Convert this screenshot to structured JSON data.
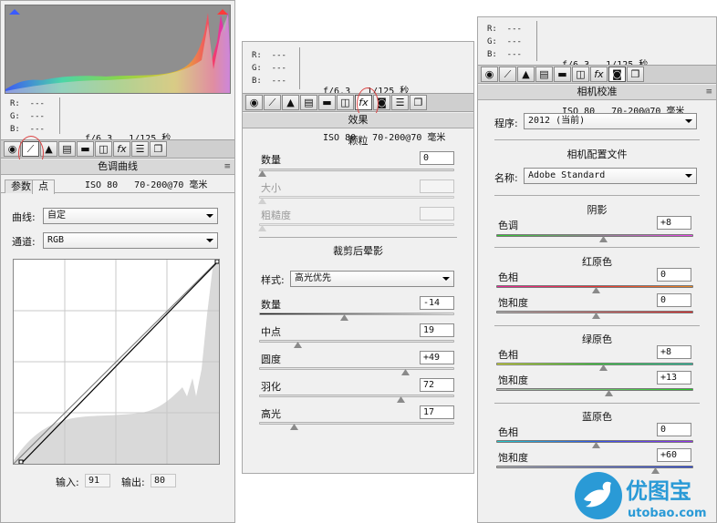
{
  "left_panel": {
    "rgb_readout": {
      "r": "R:  ---",
      "g": "G:  ---",
      "b": "B:  ---"
    },
    "exif": {
      "line1": "f/6.3   1/125 秒",
      "line2": "ISO 80   70-200@70 毫米"
    },
    "toolbar_icons": [
      "basic-icon",
      "tone-curve-icon",
      "detail-icon",
      "hsl-icon",
      "split-toning-icon",
      "lens-icon",
      "fx-icon",
      "camera-calibration-icon",
      "presets-icon"
    ],
    "panel_title": "色调曲线",
    "tabs": [
      "参数",
      "点"
    ],
    "curve_label": "曲线:",
    "curve_value": "自定",
    "channel_label": "通道:",
    "channel_value": "RGB",
    "input_label": "输入:",
    "input_value": "91",
    "output_label": "输出:",
    "output_value": "80",
    "colors": {
      "curve_line": "#000000",
      "circle": "#dd4444"
    }
  },
  "mid_panel": {
    "rgb_readout": {
      "r": "R:  ---",
      "g": "G:  ---",
      "b": "B:  ---"
    },
    "exif": {
      "line1": "f/6.3   1/125 秒",
      "line2": "ISO 80   70-200@70 毫米"
    },
    "panel_title": "效果",
    "grain": {
      "title": "颗粒",
      "amount_label": "数量",
      "amount_value": "0",
      "size_label": "大小",
      "size_value": "",
      "roughness_label": "粗糙度",
      "roughness_value": ""
    },
    "vignette": {
      "title": "裁剪后晕影",
      "style_label": "样式:",
      "style_value": "高光优先",
      "amount_label": "数量",
      "amount_value": "-14",
      "midpoint_label": "中点",
      "midpoint_value": "19",
      "roundness_label": "圆度",
      "roundness_value": "+49",
      "feather_label": "羽化",
      "feather_value": "72",
      "highlights_label": "高光",
      "highlights_value": "17"
    }
  },
  "right_panel": {
    "rgb_readout": {
      "r": "R:  ---",
      "g": "G:  ---",
      "b": "B:  ---"
    },
    "exif": {
      "line1": "f/6.3   1/125 秒",
      "line2": "ISO 80   70-200@70 毫米"
    },
    "panel_title": "相机校准",
    "process_label": "程序:",
    "process_value": "2012 (当前)",
    "profile_section": "相机配置文件",
    "name_label": "名称:",
    "name_value": "Adobe Standard",
    "shadows": {
      "title": "阴影",
      "tint_label": "色调",
      "tint_value": "+8"
    },
    "red_primary": {
      "title": "红原色",
      "hue_label": "色相",
      "hue_value": "0",
      "sat_label": "饱和度",
      "sat_value": "0"
    },
    "green_primary": {
      "title": "绿原色",
      "hue_label": "色相",
      "hue_value": "+8",
      "sat_label": "饱和度",
      "sat_value": "+13"
    },
    "blue_primary": {
      "title": "蓝原色",
      "hue_label": "色相",
      "hue_value": "0",
      "sat_label": "饱和度",
      "sat_value": "+60"
    }
  },
  "watermark": {
    "brand": "优图宝",
    "url": "utobao.com",
    "color": "#2a9ad6"
  }
}
